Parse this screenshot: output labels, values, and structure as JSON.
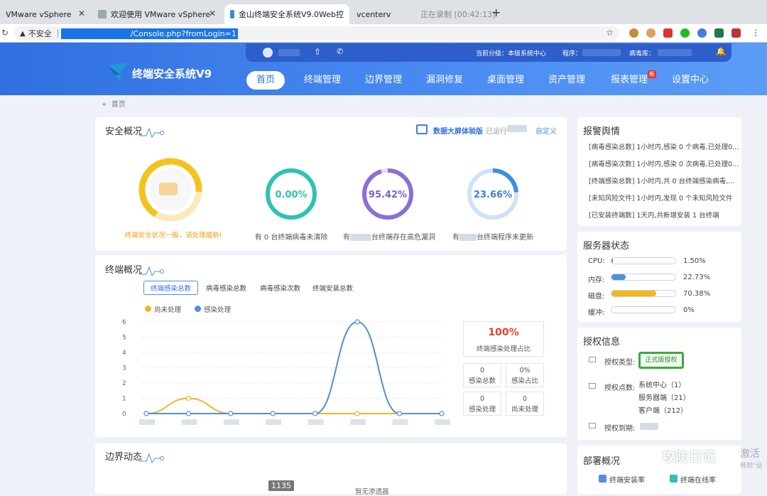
{
  "browser": {
    "tabs": [
      {
        "title": "VMware vSphere"
      },
      {
        "title": "欢迎使用 VMware vSphere"
      },
      {
        "title": "金山终端安全系统V9.0Web控"
      },
      {
        "title": "vcenterv"
      },
      {
        "title": "正在录制 [00:42:13]"
      }
    ],
    "insecure_label": "不安全",
    "url": "/Console.php?fromLogin=1",
    "close_glyph": "✕",
    "new_tab_glyph": "+"
  },
  "header": {
    "product_name": "终端安全系统V9",
    "current_level_label": "当前分级：本级系统中心",
    "program_label": "程序：",
    "virus_db_label": "病毒库："
  },
  "nav": [
    {
      "label": "首页",
      "active": true
    },
    {
      "label": "终端管理"
    },
    {
      "label": "边界管理"
    },
    {
      "label": "漏洞修复"
    },
    {
      "label": "桌面管理"
    },
    {
      "label": "资产管理"
    },
    {
      "label": "报表管理",
      "badge": "新"
    },
    {
      "label": "设置中心"
    }
  ],
  "breadcrumb": "首页",
  "security": {
    "title": "安全概况",
    "bigscreen_label": "数据大屏体验版",
    "running_label": "已运行",
    "custom_label": "自定义",
    "status_text": "终端安全状况一般，请处理威胁!",
    "rings": [
      {
        "value": "0.00%",
        "caption": "有 0 台终端病毒未清除",
        "color": "#2fc2b4",
        "fraction": 0
      },
      {
        "value": "95.42%",
        "caption_pre": "有",
        "caption_post": "台终端存在高危漏洞",
        "color": "#8a6fd8",
        "fraction": 0.9542
      },
      {
        "value": "23.66%",
        "caption_pre": "有",
        "caption_post": "台终端程序未更新",
        "color": "#3d8de6",
        "fraction": 0.2366
      }
    ]
  },
  "terminal": {
    "title": "终端概况",
    "tabs": [
      "终端感染总数",
      "病毒感染总数",
      "病毒感染次数",
      "终端安装总数"
    ],
    "legend": [
      {
        "name": "尚未处理",
        "color": "#f2b51e"
      },
      {
        "name": "感染处理",
        "color": "#4f8fe0"
      }
    ],
    "summary": {
      "percent": "100%",
      "percent_label": "终端感染处理占比"
    },
    "mini": [
      {
        "value": "0",
        "label": "感染总数"
      },
      {
        "value": "0%",
        "label": "感染占比"
      },
      {
        "value": "0",
        "label": "感染处理"
      },
      {
        "value": "0",
        "label": "尚未处理"
      }
    ]
  },
  "chart_data": {
    "type": "line",
    "x": [
      1,
      2,
      3,
      4,
      5,
      6,
      7,
      8
    ],
    "ylim": [
      0,
      6
    ],
    "yticks": [
      "0",
      "1",
      "2",
      "3",
      "4",
      "5",
      "6"
    ],
    "series": [
      {
        "name": "尚未处理",
        "color": "#f2b51e",
        "values": [
          0,
          1,
          0,
          0,
          0,
          0,
          0,
          0
        ]
      },
      {
        "name": "感染处理",
        "color": "#4f8fe0",
        "values": [
          0,
          0,
          0,
          0,
          0,
          6,
          0,
          0
        ]
      }
    ]
  },
  "border": {
    "title": "边界动态",
    "count": "1135",
    "no_chart": "暂无渗透器"
  },
  "alarms": {
    "title": "报警舆情",
    "items": [
      "[病毒感染总数] 1小时内,感染 0 个病毒,已处理0...",
      "[病毒感染次数] 1小时内,感染 0 次病毒,已处理0...",
      "[终端感染总数] 1小时内,共 0 台终端感染病毒,...",
      "[未知风险文件] 1小时内,发现 0 个未知风险文件",
      "[已安装终端数] 1天内,共新增安装 1 台终端"
    ]
  },
  "server": {
    "title": "服务器状态",
    "rows": [
      {
        "label": "CPU:",
        "value": "1.50%",
        "fraction": 0.015,
        "color": "#4f8fe0"
      },
      {
        "label": "内存:",
        "value": "22.73%",
        "fraction": 0.2273,
        "color": "#4f8fe0"
      },
      {
        "label": "磁盘:",
        "value": "70.38%",
        "fraction": 0.7038,
        "color": "#f2b51e"
      },
      {
        "label": "缓冲:",
        "value": "0%",
        "fraction": 0,
        "color": "#4f8fe0"
      }
    ]
  },
  "license": {
    "title": "授权信息",
    "type_label": "授权类型:",
    "type_badge": "正式版授权",
    "points_label": "授权点数:",
    "points": [
      "系统中心（1）",
      "服务器端（21）",
      "客户端（212）"
    ],
    "expire_label": "授权到期:"
  },
  "deploy": {
    "title": "部署概况",
    "legend": [
      "终端安装率",
      "终端在线率"
    ]
  },
  "watermark": {
    "text": "攻防日记",
    "activate_text": "激活",
    "sub": "转到\"设"
  }
}
